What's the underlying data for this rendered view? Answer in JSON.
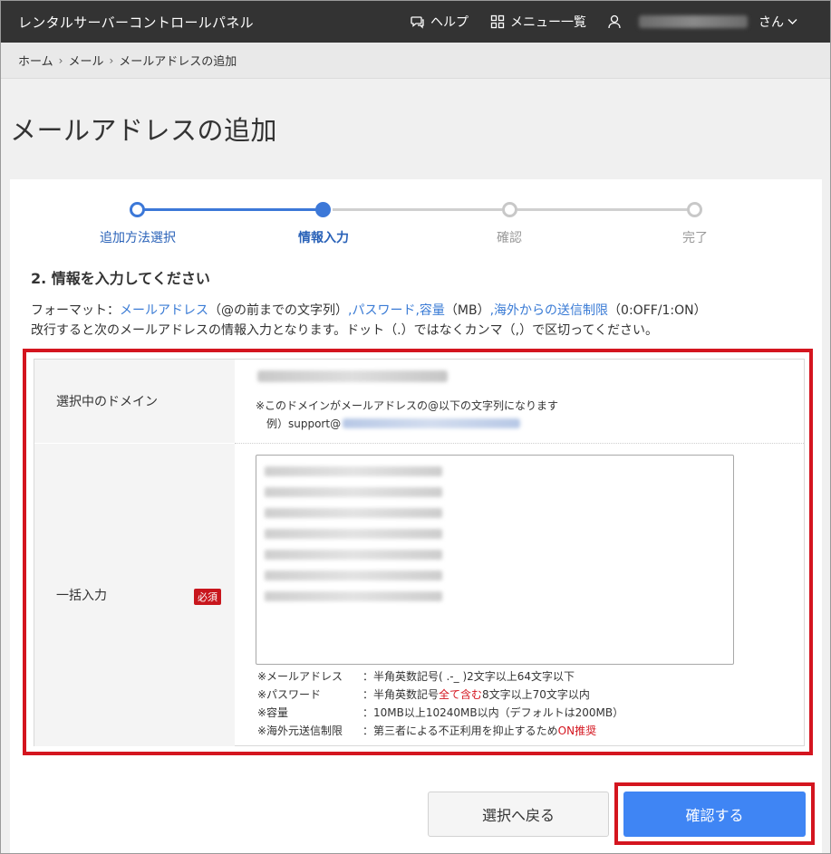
{
  "header": {
    "title": "レンタルサーバーコントロールパネル",
    "help": "ヘルプ",
    "menu_list": "メニュー一覧",
    "user_suffix": "さん",
    "icons": {
      "help": "chat-help-icon",
      "menu": "grid-icon",
      "user": "user-icon",
      "dropdown": "chevron-down-icon"
    }
  },
  "breadcrumb": {
    "home": "ホーム",
    "mail": "メール",
    "current": "メールアドレスの追加"
  },
  "page": {
    "title": "メールアドレスの追加"
  },
  "stepper": {
    "steps": [
      {
        "label": "追加方法選択",
        "state": "done"
      },
      {
        "label": "情報入力",
        "state": "current"
      },
      {
        "label": "確認",
        "state": "todo"
      },
      {
        "label": "完了",
        "state": "todo"
      }
    ],
    "colors": {
      "active": "#3c78d8",
      "inactive": "#c8c8c8"
    }
  },
  "section": {
    "heading": "2. 情報を入力してください",
    "format_prefix": "フォーマット：",
    "format_mail": "メールアドレス",
    "format_mail_note": "（@の前までの文字列）",
    "format_password": ",パスワード",
    "format_capacity": ",容量",
    "format_capacity_unit": "（MB）",
    "format_overseas": ",海外からの送信制限",
    "format_overseas_note": "（0:OFF/1:ON）",
    "note": "改行すると次のメールアドレスの情報入力となります。ドット（.）ではなくカンマ（,）で区切ってください。"
  },
  "form": {
    "domain_label": "選択中のドメイン",
    "domain_note": "※このドメインがメールアドレスの@以下の文字列になります",
    "example_prefix": "例）support@",
    "bulk_label": "一括入力",
    "required_badge": "必須",
    "rules": [
      {
        "label": "※メールアドレス",
        "text": "：半角英数記号( .-_ )2文字以上64文字以下"
      },
      {
        "label": "※パスワード",
        "text_a": "：半角英数記号",
        "text_red": "全て含む",
        "text_b": "8文字以上70文字以内"
      },
      {
        "label": "※容量",
        "text": "：10MB以上10240MB以内（デフォルトは200MB）"
      },
      {
        "label": "※海外元送信制限",
        "text_a": "：第三者による不正利用を抑止するため",
        "text_red": "ON推奨"
      }
    ]
  },
  "buttons": {
    "back": "選択へ戻る",
    "confirm": "確認する"
  },
  "colors": {
    "accent": "#3f85f4",
    "highlight": "#d4151f",
    "header_bg": "#333333",
    "link": "#3a7bd5"
  }
}
